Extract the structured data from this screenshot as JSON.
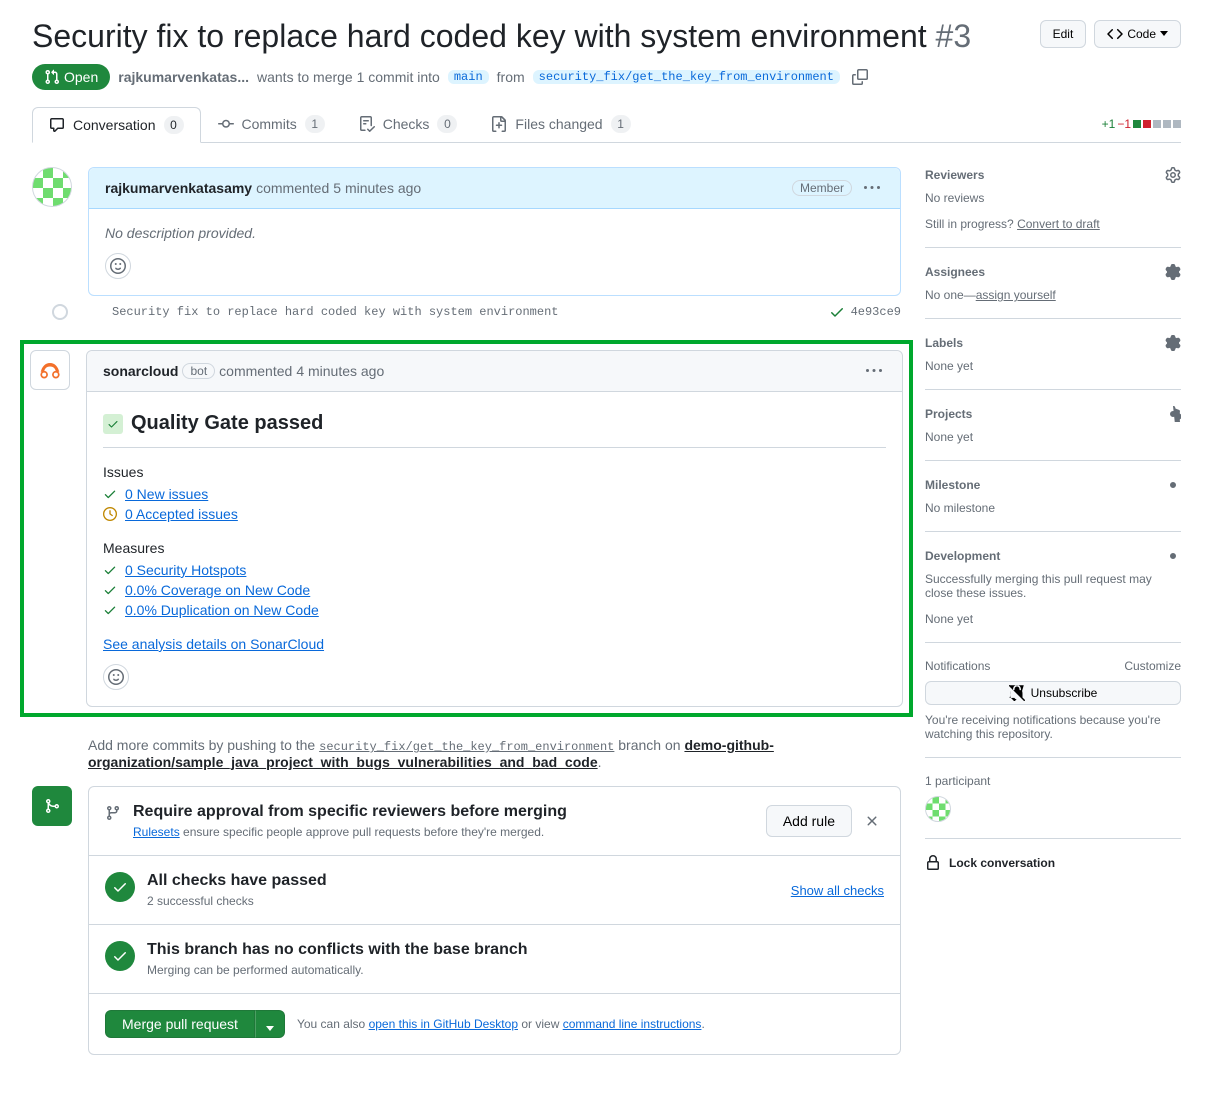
{
  "header": {
    "title": "Security fix to replace hard coded key with system environment",
    "number": "#3",
    "edit_btn": "Edit",
    "code_btn": "Code",
    "state": "Open",
    "author_trunc": "rajkumarvenkatas...",
    "merge_text_pre": "wants to merge 1 commit into",
    "base_branch": "main",
    "merge_text_mid": "from",
    "head_branch": "security_fix/get_the_key_from_environment"
  },
  "tabs": {
    "conversation": "Conversation",
    "conversation_count": "0",
    "commits": "Commits",
    "commits_count": "1",
    "checks": "Checks",
    "checks_count": "0",
    "files": "Files changed",
    "files_count": "1",
    "diff_add": "+1",
    "diff_del": "−1"
  },
  "comment1": {
    "author": "rajkumarvenkatasamy",
    "time_prefix": "commented",
    "time": "5 minutes ago",
    "badge": "Member",
    "body": "No description provided."
  },
  "commit": {
    "msg": "Security fix to replace hard coded key with system environment",
    "sha": "4e93ce9"
  },
  "sonar": {
    "author": "sonarcloud",
    "bot_badge": "bot",
    "time_prefix": "commented",
    "time": "4 minutes ago",
    "qg_title": "Quality Gate passed",
    "issues_title": "Issues",
    "new_issues": "0 New issues",
    "accepted": "0 Accepted issues",
    "measures_title": "Measures",
    "hotspots": "0 Security Hotspots",
    "coverage": "0.0% Coverage on New Code",
    "duplication": "0.0% Duplication on New Code",
    "analysis_link": "See analysis details on SonarCloud"
  },
  "push_hint": {
    "pre": "Add more commits by pushing to the",
    "branch": "security_fix/get_the_key_from_environment",
    "mid": "branch on",
    "repo": "demo-github-organization/sample_java_project_with_bugs_vulnerabilities_and_bad_code",
    "suffix": "."
  },
  "merge": {
    "rule_title": "Require approval from specific reviewers before merging",
    "rule_link": "Rulesets",
    "rule_desc": "ensure specific people approve pull requests before they're merged.",
    "add_rule_btn": "Add rule",
    "checks_title": "All checks have passed",
    "checks_desc": "2 successful checks",
    "show_all": "Show all checks",
    "conflict_title": "This branch has no conflicts with the base branch",
    "conflict_desc": "Merging can be performed automatically.",
    "merge_btn": "Merge pull request",
    "also_pre": "You can also",
    "desktop_link": "open this in GitHub Desktop",
    "also_mid": "or view",
    "cli_link": "command line instructions",
    "also_suffix": "."
  },
  "sidebar": {
    "reviewers_title": "Reviewers",
    "reviewers_empty": "No reviews",
    "draft_pre": "Still in progress?",
    "draft_link": "Convert to draft",
    "assignees_title": "Assignees",
    "assignees_pre": "No one—",
    "assignees_link": "assign yourself",
    "labels_title": "Labels",
    "labels_empty": "None yet",
    "projects_title": "Projects",
    "projects_empty": "None yet",
    "milestone_title": "Milestone",
    "milestone_empty": "No milestone",
    "dev_title": "Development",
    "dev_desc": "Successfully merging this pull request may close these issues.",
    "dev_empty": "None yet",
    "notif_title": "Notifications",
    "notif_customize": "Customize",
    "unsubscribe": "Unsubscribe",
    "notif_desc": "You're receiving notifications because you're watching this repository.",
    "participants": "1 participant",
    "lock": "Lock conversation"
  }
}
